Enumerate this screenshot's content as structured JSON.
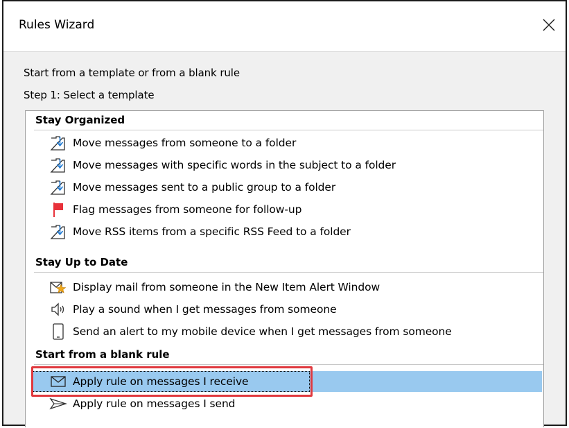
{
  "window": {
    "title": "Rules Wizard",
    "close_icon": "close-icon"
  },
  "intro_text": "Start from a template or from a blank rule",
  "step_text": "Step 1: Select a template",
  "groups": [
    {
      "header": "Stay Organized",
      "items": [
        {
          "label": "Move messages from someone to a folder",
          "icon": "move-to-folder-icon"
        },
        {
          "label": "Move messages with specific words in the subject to a folder",
          "icon": "move-to-folder-icon"
        },
        {
          "label": "Move messages sent to a public group to a folder",
          "icon": "move-to-folder-icon"
        },
        {
          "label": "Flag messages from someone for follow-up",
          "icon": "red-flag-icon"
        },
        {
          "label": "Move RSS items from a specific RSS Feed to a folder",
          "icon": "move-to-folder-icon"
        }
      ]
    },
    {
      "header": "Stay Up to Date",
      "items": [
        {
          "label": "Display mail from someone in the New Item Alert Window",
          "icon": "new-item-alert-icon"
        },
        {
          "label": "Play a sound when I get messages from someone",
          "icon": "speaker-icon"
        },
        {
          "label": "Send an alert to my mobile device when I get messages from someone",
          "icon": "mobile-device-icon"
        }
      ]
    },
    {
      "header": "Start from a blank rule",
      "items": [
        {
          "label": "Apply rule on messages I receive",
          "icon": "envelope-icon",
          "selected": true
        },
        {
          "label": "Apply rule on messages I send",
          "icon": "send-arrow-icon"
        }
      ]
    }
  ],
  "colors": {
    "selection": "#99c9ef",
    "annotation_box": "#e0393e",
    "flag": "#e8313a",
    "folder_arrow": "#1e7ad4",
    "star": "#f0a81c"
  }
}
